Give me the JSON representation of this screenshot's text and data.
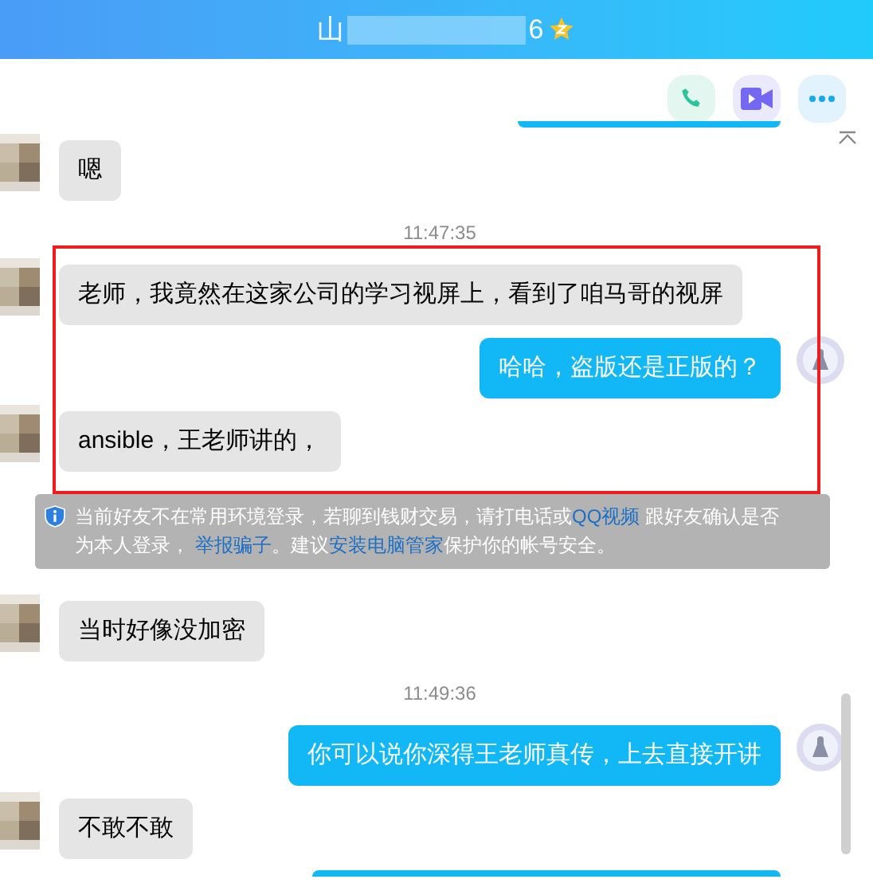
{
  "window": {
    "title_start": "山",
    "title_end": "6"
  },
  "toolbar": [
    {
      "kind": "phone"
    },
    {
      "kind": "video"
    },
    {
      "kind": "more"
    }
  ],
  "messages": [
    {
      "kind": "clipped_outgoing",
      "highlighted": false
    },
    {
      "kind": "incoming",
      "text": "嗯",
      "highlighted": false
    },
    {
      "kind": "time",
      "text": "11:47:35",
      "highlighted": false
    },
    {
      "kind": "incoming",
      "text": "老师，我竟然在这家公司的学习视屏上，看到了咱马哥的视屏",
      "highlighted": true
    },
    {
      "kind": "outgoing",
      "text": "哈哈，盗版还是正版的？",
      "highlighted": true
    },
    {
      "kind": "incoming",
      "text": "ansible，王老师讲的，",
      "highlighted": true
    },
    {
      "kind": "notice",
      "segments": [
        {
          "text": "当前好友不在常用环境登录，若聊到钱财交易，请打电话或",
          "link": false
        },
        {
          "text": "QQ视频",
          "link": true
        },
        {
          "text": " 跟好友确认是否为本人登录， ",
          "link": false
        },
        {
          "text": "举报骗子",
          "link": true
        },
        {
          "text": "。建议",
          "link": false
        },
        {
          "text": "安装电脑管家",
          "link": true
        },
        {
          "text": "保护你的帐号安全。",
          "link": false
        }
      ],
      "highlighted": false
    },
    {
      "kind": "incoming",
      "text": "当时好像没加密",
      "highlighted": false
    },
    {
      "kind": "time",
      "text": "11:49:36",
      "highlighted": false
    },
    {
      "kind": "outgoing",
      "text": "你可以说你深得王老师真传，上去直接开讲",
      "highlighted": false
    },
    {
      "kind": "incoming",
      "text": "不敢不敢",
      "highlighted": false
    },
    {
      "kind": "clipped_outgoing",
      "highlighted": false
    }
  ]
}
